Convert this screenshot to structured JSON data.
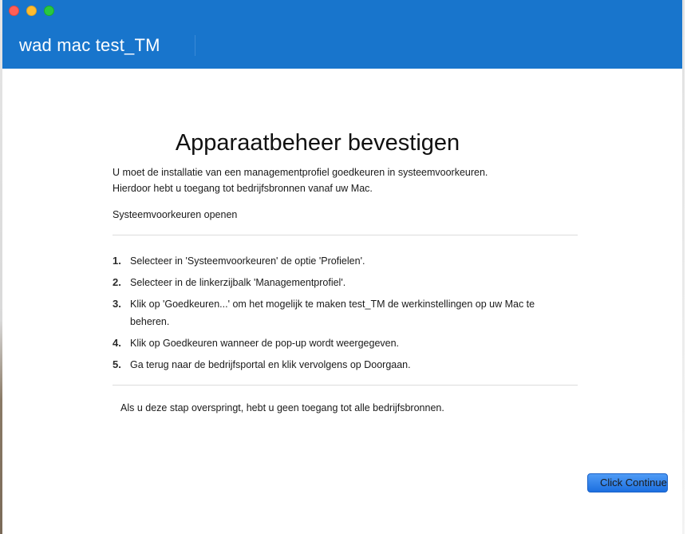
{
  "window": {
    "app_title": "wad mac test_TM"
  },
  "content": {
    "title": "Apparaatbeheer bevestigen",
    "intro_line1": "U moet de installatie van een managementprofiel goedkeuren in systeemvoorkeuren.",
    "intro_line2": "Hierdoor hebt u toegang tot bedrijfsbronnen vanaf uw Mac.",
    "open_prefs": "Systeemvoorkeuren openen",
    "steps": [
      {
        "num": "1.",
        "text": "Selecteer in 'Systeemvoorkeuren' de optie 'Profielen'."
      },
      {
        "num": "2.",
        "text": "Selecteer in de linkerzijbalk 'Managementprofiel'."
      },
      {
        "num": "3.",
        "text": "Klik op 'Goedkeuren...' om het mogelijk te maken test_TM de werkinstellingen op uw Mac te beheren."
      },
      {
        "num": "4.",
        "text": "Klik op Goedkeuren wanneer de pop-up wordt weergegeven."
      },
      {
        "num": "5.",
        "text": "Ga terug naar de bedrijfsportal en klik vervolgens op Doorgaan."
      }
    ],
    "skip_note": "Als u deze stap overspringt, hebt u geen toegang tot alle bedrijfsbronnen.",
    "continue_label": "Click Continue"
  },
  "colors": {
    "header": "#1875cc",
    "button": "#2b7de9"
  }
}
